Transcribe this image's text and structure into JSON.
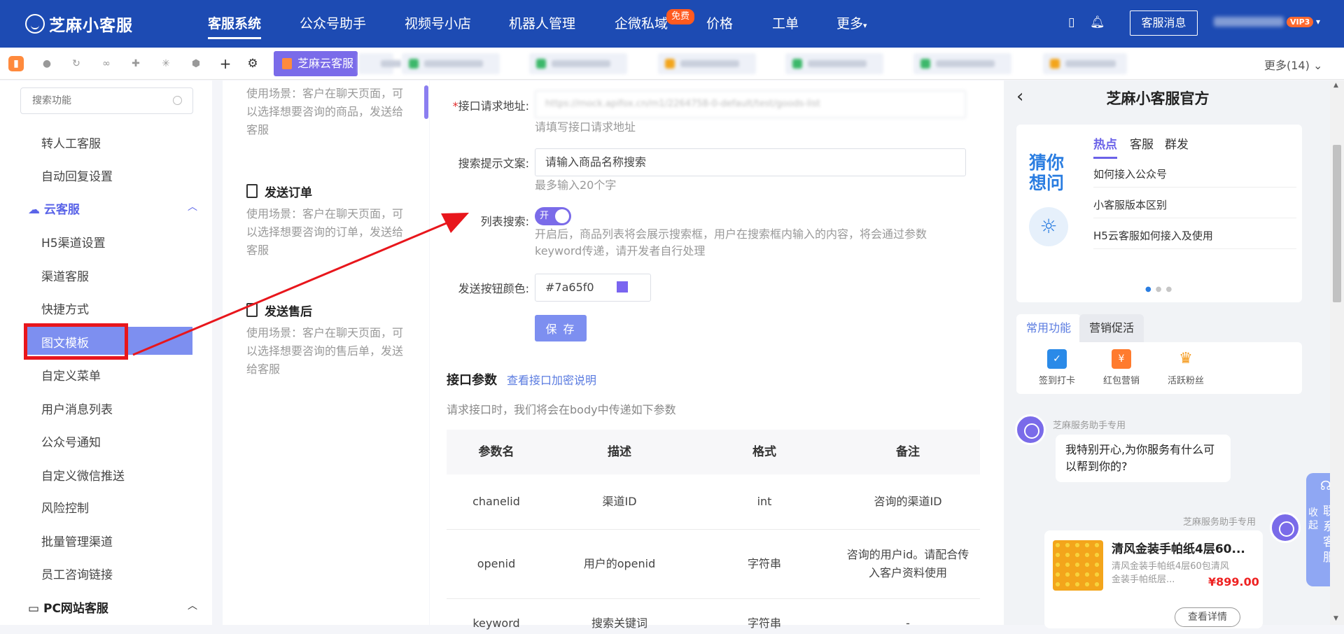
{
  "brand": {
    "logo_text": "芝麻小客服"
  },
  "topnav": {
    "items": [
      "客服系统",
      "公众号助手",
      "视频号小店",
      "机器人管理",
      "企微私域",
      "价格",
      "工单",
      "更多"
    ],
    "free_badge": "免费",
    "service_message_button": "客服消息",
    "vip_badge": "VIP3"
  },
  "tabs": {
    "active_chat": "芝麻云客服",
    "more": "更多(14)"
  },
  "sidebar": {
    "search_placeholder": "搜索功能",
    "top_items": [
      "转人工客服",
      "自动回复设置"
    ],
    "group_cloud": "云客服",
    "cloud_items": [
      "H5渠道设置",
      "渠道客服",
      "快捷方式",
      "图文模板",
      "自定义菜单",
      "用户消息列表",
      "公众号通知",
      "自定义微信推送",
      "风险控制",
      "批量管理渠道",
      "员工咨询链接"
    ],
    "group_pc": "PC网站客服"
  },
  "templates": {
    "goods_desc": "使用场景：客户在聊天页面，可以选择想要咨询的商品，发送给客服",
    "order_title": "发送订单",
    "order_desc": "使用场景：客户在聊天页面，可以选择想要咨询的订单，发送给客服",
    "aftersale_title": "发送售后",
    "aftersale_desc": "使用场景：客户在聊天页面，可以选择想要咨询的售后单，发送给客服"
  },
  "form": {
    "url_label": "接口请求地址:",
    "url_value": "https://mock.apifox.cn/m1/2264758-0-default/test/goods-list",
    "url_hint": "请填写接口请求地址",
    "search_label": "搜索提示文案:",
    "search_value": "请输入商品名称搜索",
    "search_hint": "最多输入20个字",
    "list_label": "列表搜索:",
    "toggle_text": "开",
    "list_hint": "开启后，商品列表将会展示搜索框，用户在搜索框内输入的内容，将会通过参数keyword传递，请开发者自行处理",
    "color_label": "发送按钮颜色:",
    "color_value": "#7a65f0",
    "save_button": "保 存"
  },
  "params": {
    "title": "接口参数",
    "link": "查看接口加密说明",
    "subtitle": "请求接口时，我们将会在body中传递如下参数",
    "headers": [
      "参数名",
      "描述",
      "格式",
      "备注"
    ],
    "rows": [
      [
        "chanelid",
        "渠道ID",
        "int",
        "咨询的渠道ID"
      ],
      [
        "openid",
        "用户的openid",
        "字符串",
        "咨询的用户id。请配合传入客户资料使用"
      ],
      [
        "keyword",
        "搜索关键词",
        "字符串",
        "-"
      ]
    ]
  },
  "phone": {
    "title": "芝麻小客服官方",
    "guess": "猜你想问",
    "hot_tabs": [
      "热点",
      "客服",
      "群发"
    ],
    "faqs": [
      "如何接入公众号",
      "小客服版本区别",
      "H5云客服如何接入及使用"
    ],
    "func_tabs": [
      "常用功能",
      "营销促活"
    ],
    "funcs": [
      "签到打卡",
      "红包营销",
      "活跃粉丝"
    ],
    "agent_name": "芝麻服务助手专用",
    "greeting": "我特别开心,为你服务有什么可以帮到你的?",
    "product_title": "清风金装手帕纸4层60...",
    "product_desc": "清风金装手帕纸4层60包清风金装手帕纸层...",
    "product_price": "¥899.00",
    "product_button": "查看详情"
  },
  "contact": {
    "collapse": "收起",
    "label": "联系客服"
  },
  "colors": {
    "primary": "#1d4bb3",
    "accent": "#7a6be9",
    "highlight": "#e8161c"
  }
}
